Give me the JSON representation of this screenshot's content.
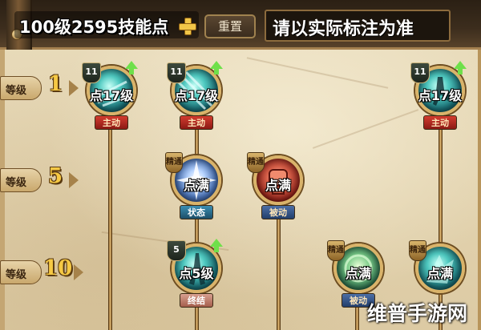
{
  "header": {
    "points_text": "100级2595技能点",
    "reset_label": "重置",
    "notice_text": "请以实际标注为准"
  },
  "levels": [
    {
      "label": "等级",
      "value": "1"
    },
    {
      "label": "等级",
      "value": "5"
    },
    {
      "label": "等级",
      "value": "10"
    }
  ],
  "skills": [
    {
      "badge": "11",
      "text": "点17级",
      "tag": "主动",
      "color": "teal",
      "upgradable": true
    },
    {
      "badge": "11",
      "text": "点17级",
      "tag": "主动",
      "color": "teal",
      "upgradable": true
    },
    {
      "badge": "11",
      "text": "点17级",
      "tag": "主动",
      "color": "teal",
      "upgradable": true
    },
    {
      "badge": "精通",
      "text": "点满",
      "tag": "状态",
      "color": "blue",
      "upgradable": false
    },
    {
      "badge": "精通",
      "text": "点满",
      "tag": "被动",
      "color": "red",
      "upgradable": false
    },
    {
      "badge": "5",
      "text": "点5级",
      "tag": "终结",
      "color": "teal",
      "upgradable": true
    },
    {
      "badge": "精通",
      "text": "点满",
      "tag": "被动",
      "color": "green",
      "upgradable": false
    },
    {
      "badge": "精通",
      "text": "点满",
      "tag": "",
      "color": "teal",
      "upgradable": false
    }
  ],
  "watermark": "维普手游网",
  "icons": {
    "plus": "plus-icon",
    "upgrade": "upgrade-arrow-icon"
  },
  "colors": {
    "level_number": "#f6c944",
    "upgrade_arrow": "#6fe04a",
    "tag_active": "#d33b2f",
    "tag_passive": "#4c6fa6"
  }
}
